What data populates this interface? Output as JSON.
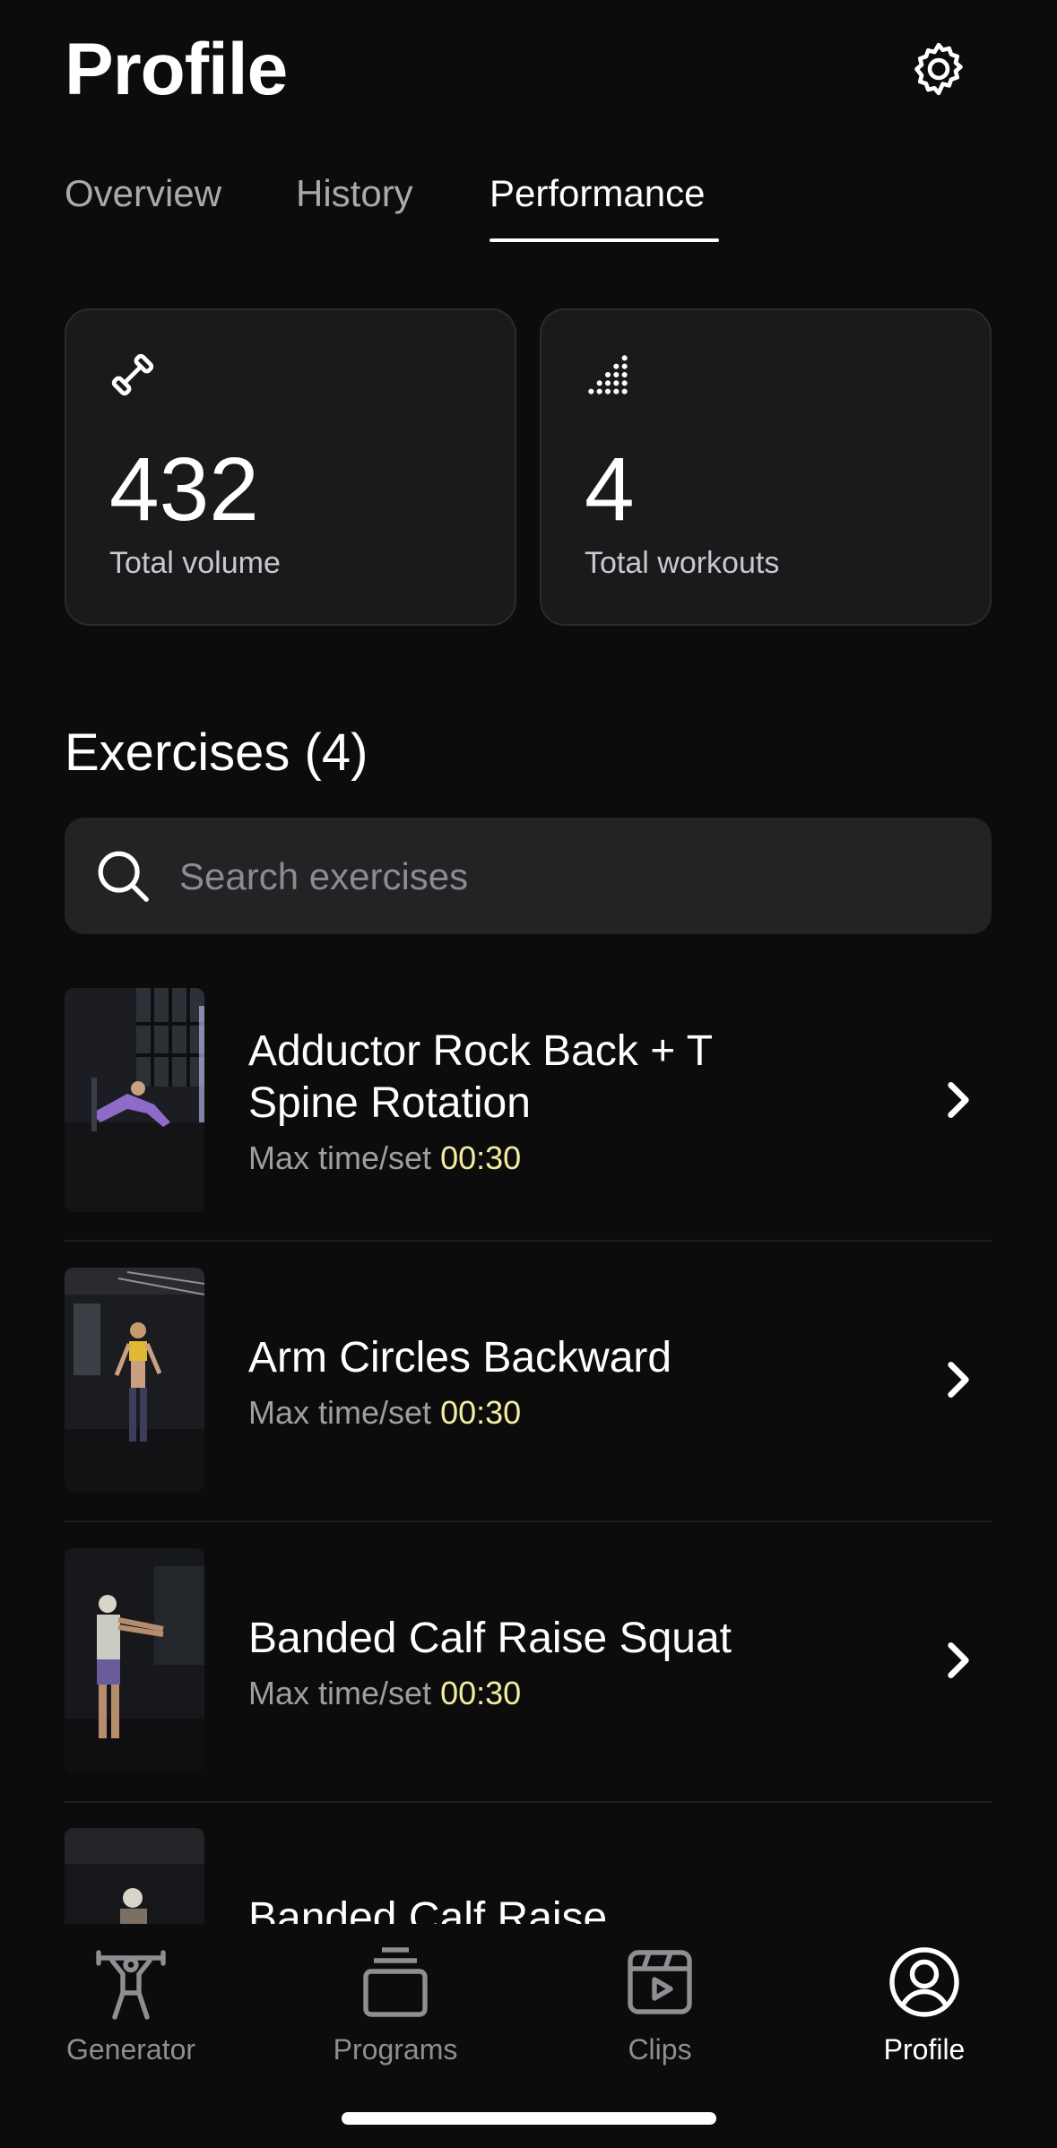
{
  "header": {
    "title": "Profile"
  },
  "tabs": [
    {
      "label": "Overview"
    },
    {
      "label": "History"
    },
    {
      "label": "Performance"
    }
  ],
  "stats": [
    {
      "value": "432",
      "label": "Total volume",
      "icon": "dumbbell-icon"
    },
    {
      "value": "4",
      "label": "Total workouts",
      "icon": "dot-grid-icon"
    }
  ],
  "exercises": {
    "heading": "Exercises (4)",
    "search_placeholder": "Search exercises",
    "items": [
      {
        "name": "Adductor Rock Back + T Spine Rotation",
        "meta_label": "Max time/set",
        "meta_value": "00:30"
      },
      {
        "name": "Arm Circles Backward",
        "meta_label": "Max time/set",
        "meta_value": "00:30"
      },
      {
        "name": "Banded Calf Raise Squat",
        "meta_label": "Max time/set",
        "meta_value": "00:30"
      },
      {
        "name": "Banded Calf Raise"
      }
    ]
  },
  "nav": [
    {
      "label": "Generator",
      "icon": "figure-icon"
    },
    {
      "label": "Programs",
      "icon": "stack-icon"
    },
    {
      "label": "Clips",
      "icon": "clip-icon"
    },
    {
      "label": "Profile",
      "icon": "profile-icon"
    }
  ],
  "colors": {
    "background": "#0c0c0d",
    "card": "#1a1a1c",
    "accent_value": "#f3eda0"
  }
}
